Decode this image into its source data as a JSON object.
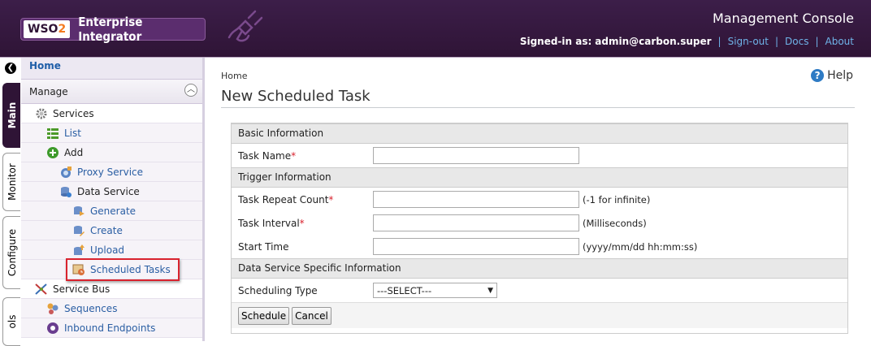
{
  "header": {
    "logo_wso": "WSO",
    "logo_two": "2",
    "product": "Enterprise Integrator",
    "console_title": "Management Console",
    "signed_in_label": "Signed-in as:",
    "signed_in_user": "admin@carbon.super",
    "signout": "Sign-out",
    "docs": "Docs",
    "about": "About",
    "link_color": "#6fb3e8",
    "bg_color": "#2f1436"
  },
  "vtabs": {
    "main": "Main",
    "monitor": "Monitor",
    "configure": "Configure",
    "tools": "ols"
  },
  "menu": {
    "home": "Home",
    "manage": "Manage",
    "items": [
      {
        "label": "Services",
        "icon": "gear-services-icon"
      },
      {
        "label": "List",
        "icon": "list-icon"
      },
      {
        "label": "Add",
        "icon": "add-icon"
      },
      {
        "label": "Proxy Service",
        "icon": "proxy-service-icon"
      },
      {
        "label": "Data Service",
        "icon": "database-icon"
      },
      {
        "label": "Generate",
        "icon": "generate-icon"
      },
      {
        "label": "Create",
        "icon": "create-icon"
      },
      {
        "label": "Upload",
        "icon": "upload-icon"
      },
      {
        "label": "Scheduled Tasks",
        "icon": "scheduled-tasks-icon"
      },
      {
        "label": "Service Bus",
        "icon": "service-bus-icon"
      },
      {
        "label": "Sequences",
        "icon": "sequences-icon"
      },
      {
        "label": "Inbound Endpoints",
        "icon": "inbound-endpoints-icon"
      }
    ]
  },
  "content": {
    "breadcrumb": "Home",
    "help": "Help",
    "title": "New Scheduled Task",
    "sections": {
      "basic": "Basic Information",
      "trigger": "Trigger Information",
      "dataservice": "Data Service Specific Information"
    },
    "fields": {
      "task_name": {
        "label": "Task Name",
        "value": ""
      },
      "repeat_count": {
        "label": "Task Repeat Count",
        "value": "",
        "hint": "(-1 for infinite)"
      },
      "interval": {
        "label": "Task Interval",
        "value": "",
        "hint": "(Milliseconds)"
      },
      "start_time": {
        "label": "Start Time",
        "value": "",
        "hint": "(yyyy/mm/dd hh:mm:ss)"
      },
      "scheduling_type": {
        "label": "Scheduling Type",
        "selected": "---SELECT---"
      }
    },
    "required_mark": "*",
    "buttons": {
      "schedule": "Schedule",
      "cancel": "Cancel"
    }
  }
}
